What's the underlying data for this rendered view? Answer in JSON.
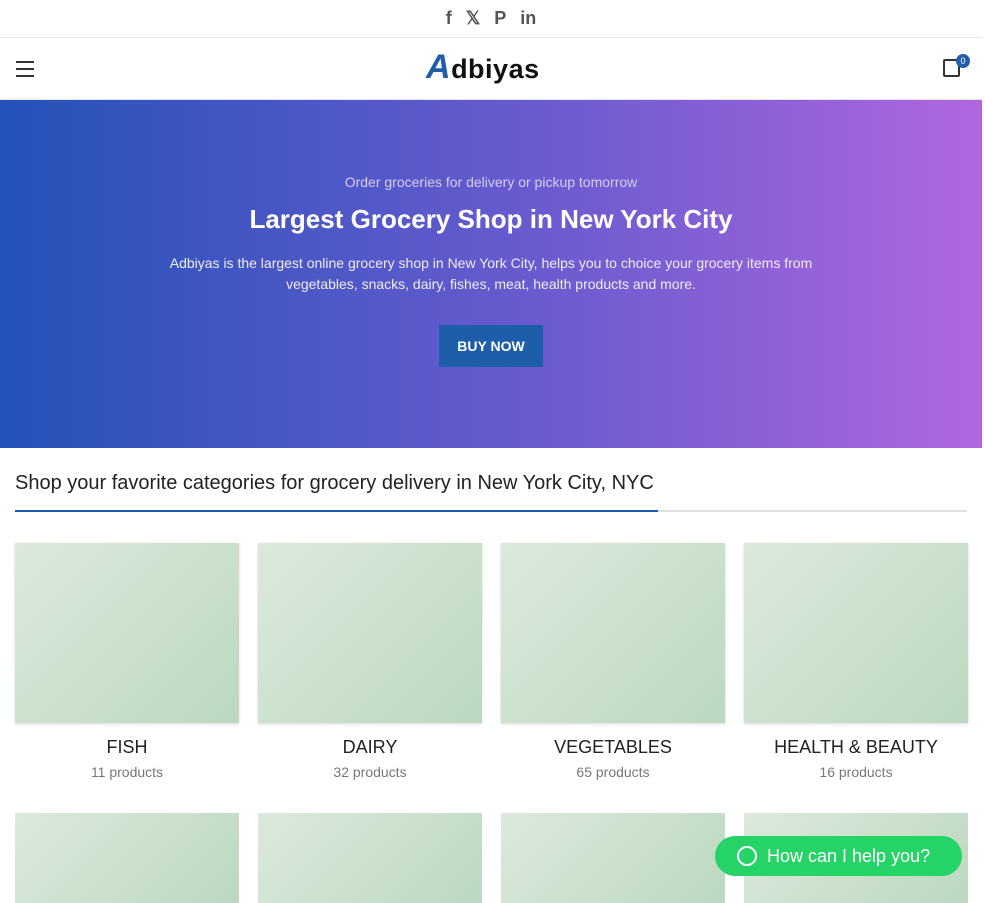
{
  "social": [
    "f",
    "𝕏",
    "P",
    "in"
  ],
  "header": {
    "logo": "Adbiyas",
    "cart_count": "0"
  },
  "hero": {
    "subtitle": "Order groceries for delivery or pickup tomorrow",
    "title": "Largest Grocery Shop in New York City",
    "text": "Adbiyas is the largest online grocery shop in New York City, helps you to choice your grocery items from vegetables, snacks, dairy, fishes, meat, health products and more.",
    "button": "BUY NOW"
  },
  "categories": {
    "title": "Shop your favorite categories for grocery delivery in New York City, NYC",
    "items": [
      {
        "name": "FISH",
        "count": "11 products"
      },
      {
        "name": "DAIRY",
        "count": "32 products"
      },
      {
        "name": "VEGETABLES",
        "count": "65 products"
      },
      {
        "name": "HEALTH & BEAUTY",
        "count": "16 products"
      }
    ]
  },
  "whatsapp": {
    "label": "How can I help you?"
  },
  "colors": {
    "accent": "#1d5ea8",
    "whatsapp": "#25d366"
  }
}
